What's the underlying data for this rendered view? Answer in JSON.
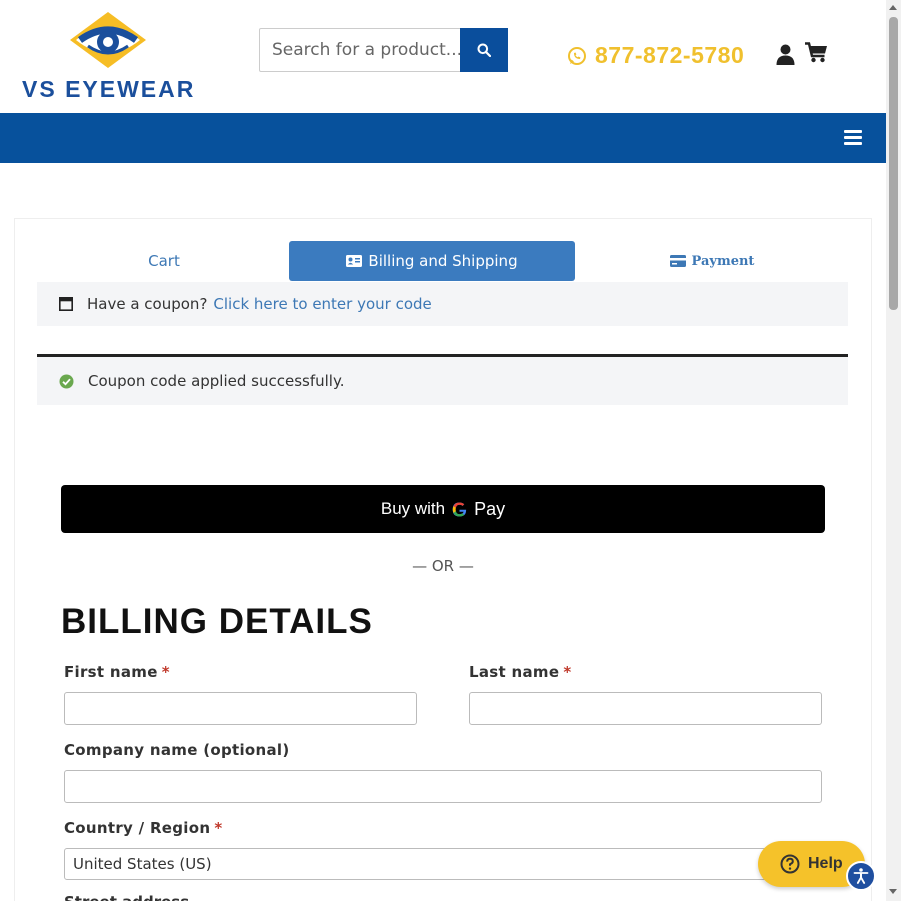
{
  "header": {
    "logo_text": "VS EYEWEAR",
    "search_placeholder": "Search for a product...",
    "phone": "877-872-5780",
    "brand_blue": "#07519c",
    "brand_yellow": "#f0c02e"
  },
  "steps": {
    "cart": "Cart",
    "billing": "Billing and Shipping",
    "payment": "Payment"
  },
  "coupon": {
    "prompt": "Have a coupon?",
    "link": "Click here to enter your code"
  },
  "notice": {
    "success": "Coupon code applied successfully."
  },
  "gpay": {
    "prefix": "Buy with",
    "pay": "Pay"
  },
  "or_text": "— OR —",
  "billing": {
    "title": "BILLING DETAILS",
    "required_marker": "*",
    "first_name_label": "First name",
    "last_name_label": "Last name",
    "company_label": "Company name (optional)",
    "country_label": "Country / Region",
    "country_value": "United States (US)",
    "street_label": "Street address"
  },
  "help": {
    "label": "Help"
  }
}
